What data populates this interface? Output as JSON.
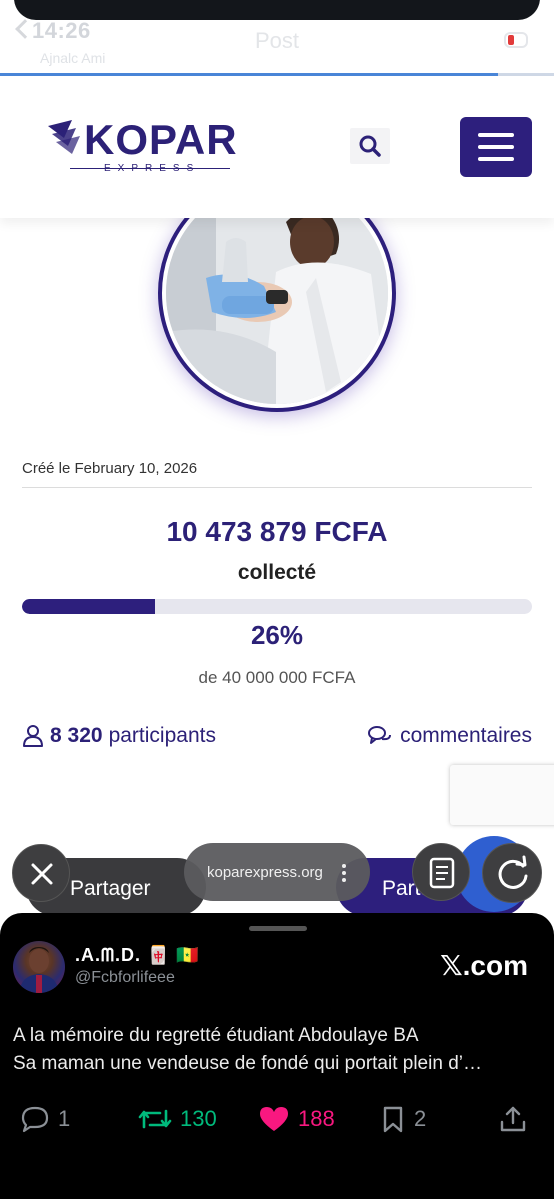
{
  "status": {
    "time": "14:26",
    "title": "Post",
    "subtitle": "Ajnalc Ami"
  },
  "header": {
    "logo_text": "KOPAR",
    "logo_sub": "EXPRESS"
  },
  "campaign": {
    "created": "Créé le February 10, 2026",
    "amount": "10 473 879 FCFA",
    "collected_label": "collecté",
    "progress_fraction": 0.26,
    "percent": "26%",
    "goal": "de 40 000 000 FCFA",
    "participants_count": "8 320",
    "participants_label": "participants",
    "comments_label": "commentaires"
  },
  "actions": {
    "share_left": "Partager",
    "share_right": "Partager"
  },
  "browser": {
    "url": "koparexpress.org"
  },
  "tweet": {
    "display_name": ".A.ᗰ.D. 🀄 🇸🇳",
    "handle": "@Fcbforlifeee",
    "brand": "𝕏.com",
    "line1": "A la mémoire du regretté étudiant Abdoulaye BA",
    "line2": "Sa maman une vendeuse de fondé qui portait plein d’…",
    "replies": "1",
    "retweets": "130",
    "likes": "188",
    "bookmarks": "2"
  },
  "colors": {
    "brand": "#2d1f7d",
    "retweet": "#00ba7c",
    "like": "#f91880",
    "browser_accent": "#2f5fd0"
  }
}
